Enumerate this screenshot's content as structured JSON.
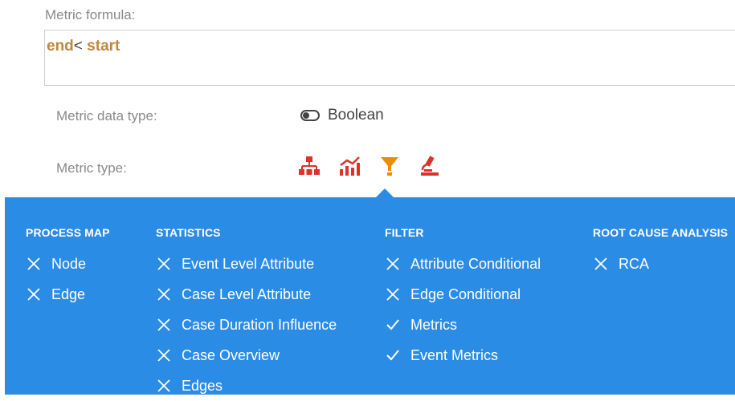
{
  "formula": {
    "label": "Metric formula:",
    "tokens": [
      "end",
      "<",
      " start"
    ]
  },
  "data_type": {
    "label": "Metric data type:",
    "value": "Boolean",
    "icon": "toggle-icon"
  },
  "metric_type": {
    "label": "Metric type:",
    "icons": [
      "process-map-icon",
      "statistics-icon",
      "filter-icon",
      "microscope-icon"
    ],
    "active_index": 2,
    "icon_colors": {
      "default": "#e0302a",
      "active": "#f08a00"
    }
  },
  "panel": {
    "color": "#2b8ce6",
    "columns": [
      {
        "heading": "PROCESS MAP",
        "items": [
          {
            "label": "Node",
            "state": "x"
          },
          {
            "label": "Edge",
            "state": "x"
          }
        ]
      },
      {
        "heading": "STATISTICS",
        "items": [
          {
            "label": "Event Level Attribute",
            "state": "x"
          },
          {
            "label": "Case Level Attribute",
            "state": "x"
          },
          {
            "label": "Case Duration Influence",
            "state": "x"
          },
          {
            "label": "Case Overview",
            "state": "x"
          },
          {
            "label": "Edges",
            "state": "x"
          }
        ]
      },
      {
        "heading": "FILTER",
        "items": [
          {
            "label": "Attribute Conditional",
            "state": "x"
          },
          {
            "label": "Edge Conditional",
            "state": "x"
          },
          {
            "label": "Metrics",
            "state": "check"
          },
          {
            "label": "Event Metrics",
            "state": "check"
          }
        ]
      },
      {
        "heading": "ROOT CAUSE ANALYSIS",
        "items": [
          {
            "label": "RCA",
            "state": "x"
          }
        ]
      }
    ]
  }
}
